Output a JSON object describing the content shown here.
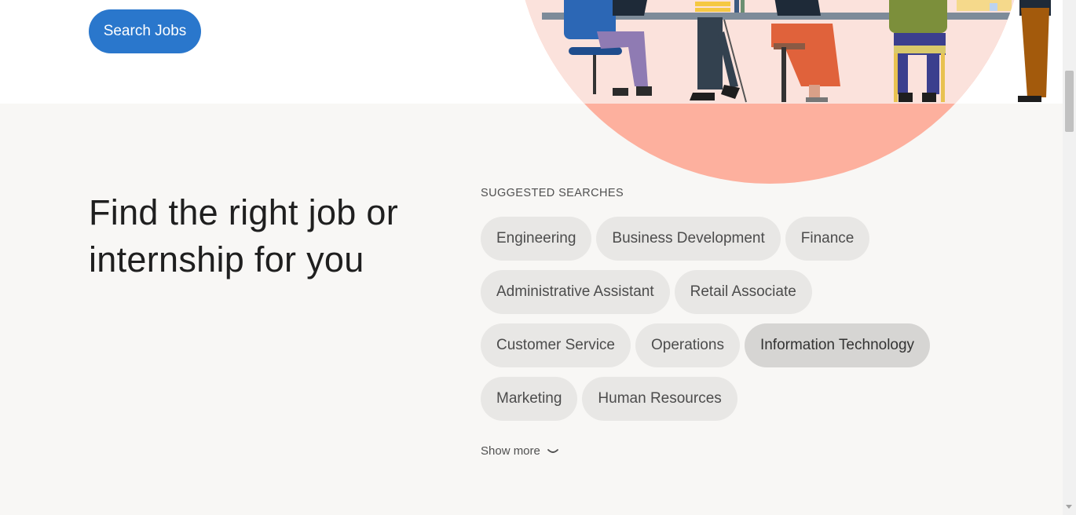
{
  "hero": {
    "search_button_label": "Search Jobs"
  },
  "main": {
    "headline": "Find the right job or internship for you",
    "suggested_heading": "SUGGESTED SEARCHES",
    "chips": [
      "Engineering",
      "Business Development",
      "Finance",
      "Administrative Assistant",
      "Retail Associate",
      "Customer Service",
      "Operations",
      "Information Technology",
      "Marketing",
      "Human Resources"
    ],
    "show_more_label": "Show more"
  },
  "colors": {
    "primary": "#2a77cc",
    "chip_bg": "#e8e7e5",
    "chip_active_bg": "#d6d5d3",
    "page_bg": "#f8f7f5",
    "illustration_circle": "#fdb09e"
  },
  "icons": {
    "show_more": "chevron-down-icon"
  }
}
